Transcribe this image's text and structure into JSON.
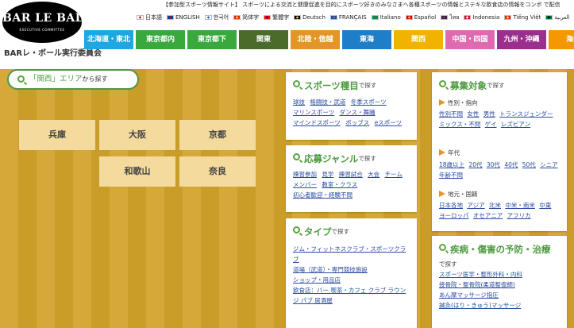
{
  "logo": {
    "title": "BAR LE BALL",
    "subtitle": "EXECUTIVE COMMITTEE"
  },
  "site_name": "BARレ・ボール実行委員会",
  "tagline": "【参加型スポーツ情報サイト】 スポーツによる交流と健康促進を目的にスポーツ好きのみなさまへ各種スポーツの情報とステキな飲食店の情報をコンポ で配信",
  "languages": [
    {
      "label": "日本語",
      "flag": "#ffffff",
      "dot": "#d00"
    },
    {
      "label": "ENGLISH",
      "flag": "#1f3a8a",
      "dot": "#c00"
    },
    {
      "label": "한국어",
      "flag": "#ffffff",
      "dot": "#1a5fb4"
    },
    {
      "label": "简体字",
      "flag": "#de2910",
      "dot": "#ffde00"
    },
    {
      "label": "繁體字",
      "flag": "#fe0000",
      "dot": "#000095"
    },
    {
      "label": "Deutsch",
      "flag": "#000000",
      "dot": "#ffce00"
    },
    {
      "label": "FRANÇAIS",
      "flag": "#0055a4",
      "dot": "#ef4135"
    },
    {
      "label": "Italiano",
      "flag": "#009246",
      "dot": "#ce2b37"
    },
    {
      "label": "Español",
      "flag": "#c60b1e",
      "dot": "#ffc400"
    },
    {
      "label": "ไทย",
      "flag": "#2d2a4a",
      "dot": "#a51931"
    },
    {
      "label": "Indonesia",
      "flag": "#ce1126",
      "dot": "#ffffff"
    },
    {
      "label": "Tiếng Việt",
      "flag": "#da251d",
      "dot": "#ffff00"
    },
    {
      "label": "العربية",
      "flag": "#00732f",
      "dot": "#000000"
    }
  ],
  "region_tabs": [
    {
      "label": "北海道・東北",
      "color": "#1ea7e0"
    },
    {
      "label": "東京都内",
      "color": "#3aa93d"
    },
    {
      "label": "東京都下",
      "color": "#3aa93d"
    },
    {
      "label": "関東",
      "color": "#4a6b2a"
    },
    {
      "label": "北陸・信越",
      "color": "#e39627"
    },
    {
      "label": "東海",
      "color": "#1e7ec8"
    },
    {
      "label": "関西",
      "color": "#f2b300"
    },
    {
      "label": "中国・四国",
      "color": "#e06ab0"
    },
    {
      "label": "九州・沖縄",
      "color": "#9b2f8e"
    },
    {
      "label": "海外",
      "color": "#f39800"
    }
  ],
  "area_search": {
    "label": "「関西」エリア",
    "suffix": "から探す"
  },
  "prefectures": [
    "兵庫",
    "大阪",
    "京都",
    "和歌山",
    "奈良"
  ],
  "cards": {
    "sports": {
      "title": "スポーツ種目",
      "suffix": "で探す",
      "links": [
        "球技",
        "格闘技・武道",
        "冬季スポーツ",
        "マリンスポーツ",
        "ダンス・舞踊",
        "マインドスポーツ",
        "ボッブス",
        "eスポーツ"
      ]
    },
    "genre": {
      "title": "応募ジャンル",
      "suffix": "で探す",
      "links": [
        "練習参加",
        "見学",
        "練習試合",
        "大会",
        "チーム",
        "メンバー",
        "教室・クラス",
        "初心者歓迎・経験不問"
      ]
    },
    "type": {
      "title": "タイプ",
      "suffix": "で探す",
      "links": [
        "ジム・フィットネスクラブ・スポーツクラブ",
        "道場（武道）・専門競技施設",
        "ショップ・用品店",
        "飲食店：バー 喫茶・カフェ クラブ ラウンジ パブ 居酒屋"
      ]
    },
    "target": {
      "title": "募集対象",
      "suffix": "で探す",
      "groups": [
        {
          "title": "性別・指向",
          "links": [
            "性別不問",
            "女性",
            "男性",
            "トランスジェンダー",
            "ミックス・不問",
            "ゲイ",
            "レズビアン"
          ]
        },
        {
          "title": "年代",
          "links": [
            "18歳以上",
            "20代",
            "30代",
            "40代",
            "50代",
            "シニア",
            "年齢不問"
          ]
        },
        {
          "title": "地元・国籍",
          "links": [
            "日本各地",
            "アジア",
            "北米",
            "中米・南米",
            "中東",
            "ヨーロッパ",
            "オセアニア",
            "アフリカ"
          ]
        }
      ]
    },
    "injury": {
      "title": "疾病・傷害の予防・治療",
      "suffix": "で探す",
      "links": [
        "スポーツ医学・整形外科・内科",
        "接骨院・整骨院(柔道整復師)",
        "あん摩マッサージ指圧",
        "鍼灸(はり・きゅう)マッサージ"
      ]
    }
  }
}
